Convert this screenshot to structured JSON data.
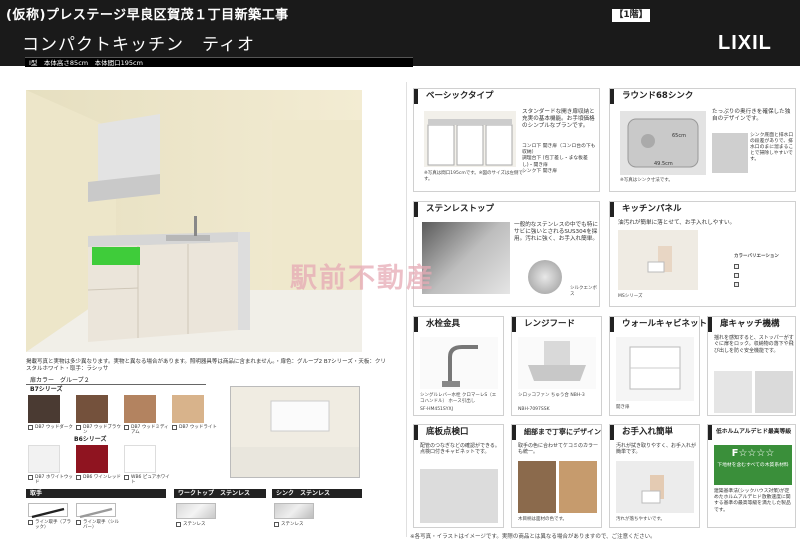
{
  "header": {
    "project_title": "(仮称)プレステージ早良区賀茂１丁目新築工事",
    "product_name": "コンパクトキッチン　ティオ",
    "floor_tag": "【1階】",
    "logo": "LIXIL",
    "spec": "I型　本体高さ85cm　本体間口195cm"
  },
  "left": {
    "notes": "掲載写真と実物は多少異なります。実物と異なる場合があります。照明器具等は商品に含まれません。・扉色：グループ2 B7シリーズ・天板：クリスタルホワイト・取手：ラシッサ",
    "door_color_label": "扉カラー　グループ２",
    "series_b7": "B7シリーズ",
    "series_b6": "B6シリーズ",
    "handle_label": "取手",
    "worktop_label": "ワークトップ　ステンレス",
    "sink_label": "シンク　ステンレス",
    "swatches_b7": [
      {
        "code": "DB7",
        "name": "ウッドダーク",
        "color": "#4a3a32"
      },
      {
        "code": "DB7",
        "name": "ウッドブラウン",
        "color": "#74513c"
      },
      {
        "code": "DB7",
        "name": "ウッドミディアム",
        "color": "#b38360"
      },
      {
        "code": "DB7",
        "name": "ウッドライト",
        "color": "#d8b38b"
      }
    ],
    "swatches_b6": [
      {
        "code": "DB7",
        "name": "ホワイトウッド",
        "color": "#f2f2f2"
      },
      {
        "code": "DB6",
        "name": "ワインレッド",
        "color": "#8f1420"
      },
      {
        "code": "WB6",
        "name": "ピュアホワイト",
        "color": "#ffffff"
      }
    ],
    "handles": [
      {
        "name": "ライン取手（ブラック）"
      },
      {
        "name": "ライン取手（シルバー）"
      }
    ],
    "worktop_name": "ステンレス",
    "sink_name": "ステンレス"
  },
  "cards": {
    "basic": {
      "title": "ベーシックタイプ",
      "desc": "スタンダードな開き扉収納と充実の基本機能。お手頃価格のシンプルなプランです。",
      "items": [
        "コンロ下 開き扉（コンロ台の下も収納）",
        "調理台下 (包丁差し・まな板差し)・開き扉",
        "シンク下 開き扉"
      ],
      "caption": "※写真は間口195cmです。※図のサイズは左側です。"
    },
    "sink": {
      "title": "ラウンド68シンク",
      "desc": "たっぷりの奥行きを確保した独自のデザインです。",
      "desc2": "シンク底面と排水口の段差がありで、排水口のまに溜まることで掃除しやすいです。",
      "caption": "※写真はシンク寸法です。",
      "dim1": "65cm",
      "dim2": "49.5cm"
    },
    "stainless": {
      "title": "ステンレストップ",
      "desc": "一般的なステンレスの中でも特にサビに強いとされるSUS304を採用。汚れに強く、お手入れ簡単。",
      "caption": "シルクエンボス"
    },
    "panel": {
      "title": "キッチンパネル",
      "desc": "油汚れが簡単に落とせて、お手入れしやすい。",
      "caption": "MSシリーズ",
      "variation_label": "カラーバリエーション"
    },
    "faucet": {
      "title": "水栓金具",
      "desc": "シングルレバー水栓 クロマーレS（エコハンドル） ホース引出し",
      "caption": "SF-HM451SYXJ"
    },
    "hood": {
      "title": "レンジフード",
      "desc": "シロッコファン ちゅう合 NBH-3",
      "caption": "NBH-7097SSK"
    },
    "wall_cab": {
      "title": "ウォールキャビネット",
      "caption": "開き扉"
    },
    "door_catch": {
      "title": "扉キャッチ機構",
      "desc": "揺れを感知すると、ストッパーがすぐに扉をロック。収納物の落下や飛び出しを防ぐ安全機能です。"
    },
    "floor_insp": {
      "title": "底板点検口",
      "desc": "配管のつなぎなどの確認ができる。点検口付きキャビネットです。"
    },
    "design": {
      "title": "細部まで丁寧にデザイン",
      "desc": "取手の色に合わせてケコミのカラーも統一。",
      "caption": "木目柄は面材の色です。"
    },
    "easy_clean": {
      "title": "お手入れ簡単",
      "desc": "汚れが拭き取りやすく、お手入れが簡単です。",
      "caption": "汚れが落ちやすいです。"
    },
    "formaldehyde": {
      "title": "低ホルムアルデヒド最高等級",
      "badge": "F☆☆☆☆",
      "badge_desc": "下地材を含むすべての木質系材料",
      "desc": "建築基準法(シックハウス対策)が定めたホルムアルデヒド放散速度に関する基準の最高等級を満たした製品です。"
    }
  },
  "footer": "※各写真・イラストはイメージです。実際の商品とは異なる場合がありますので、ご注意ください。",
  "watermark": "駅前不動産"
}
